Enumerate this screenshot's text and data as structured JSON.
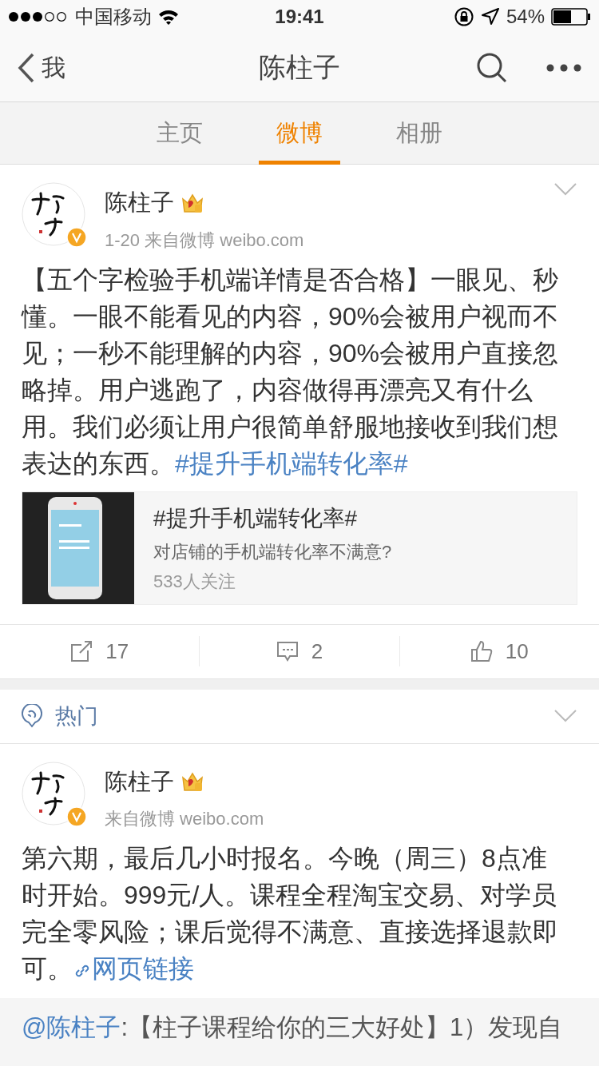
{
  "status_bar": {
    "carrier": "中国移动",
    "time": "19:41",
    "battery": "54%"
  },
  "nav": {
    "back": "我",
    "title": "陈柱子"
  },
  "tabs": [
    {
      "label": "主页",
      "selected": false
    },
    {
      "label": "微博",
      "selected": true
    },
    {
      "label": "相册",
      "selected": false
    }
  ],
  "posts": [
    {
      "author": "陈柱子",
      "meta": "1-20  来自微博 weibo.com",
      "text": "【五个字检验手机端详情是否合格】一眼见、秒懂。一眼不能看见的内容，90%会被用户视而不见；一秒不能理解的内容，90%会被用户直接忽略掉。用户逃跑了，内容做得再漂亮又有什么用。我们必须让用户很简单舒服地接收到我们想表达的东西。",
      "link": {
        "kind": "hashtag",
        "label": "#提升手机端转化率#"
      },
      "card": {
        "title": "#提升手机端转化率#",
        "subtitle": "对店铺的手机端转化率不满意?",
        "followers": "533人关注"
      },
      "actions": [
        {
          "kind": "repost",
          "count": "17"
        },
        {
          "kind": "comment",
          "count": "2"
        },
        {
          "kind": "like",
          "count": "10"
        }
      ]
    }
  ],
  "section": {
    "label": "热门"
  },
  "hot_post": {
    "author": "陈柱子",
    "meta": "来自微博 weibo.com",
    "text": "第六期，最后几小时报名。今晚（周三）8点准时开始。999元/人。课程全程淘宝交易、对学员完全零风险；课后觉得不满意、直接选择退款即可。",
    "link": {
      "kind": "web",
      "label": "网页链接"
    },
    "quote": {
      "mention": "@陈柱子",
      "text": ":【柱子课程给你的三大好处】1）发现自"
    }
  }
}
